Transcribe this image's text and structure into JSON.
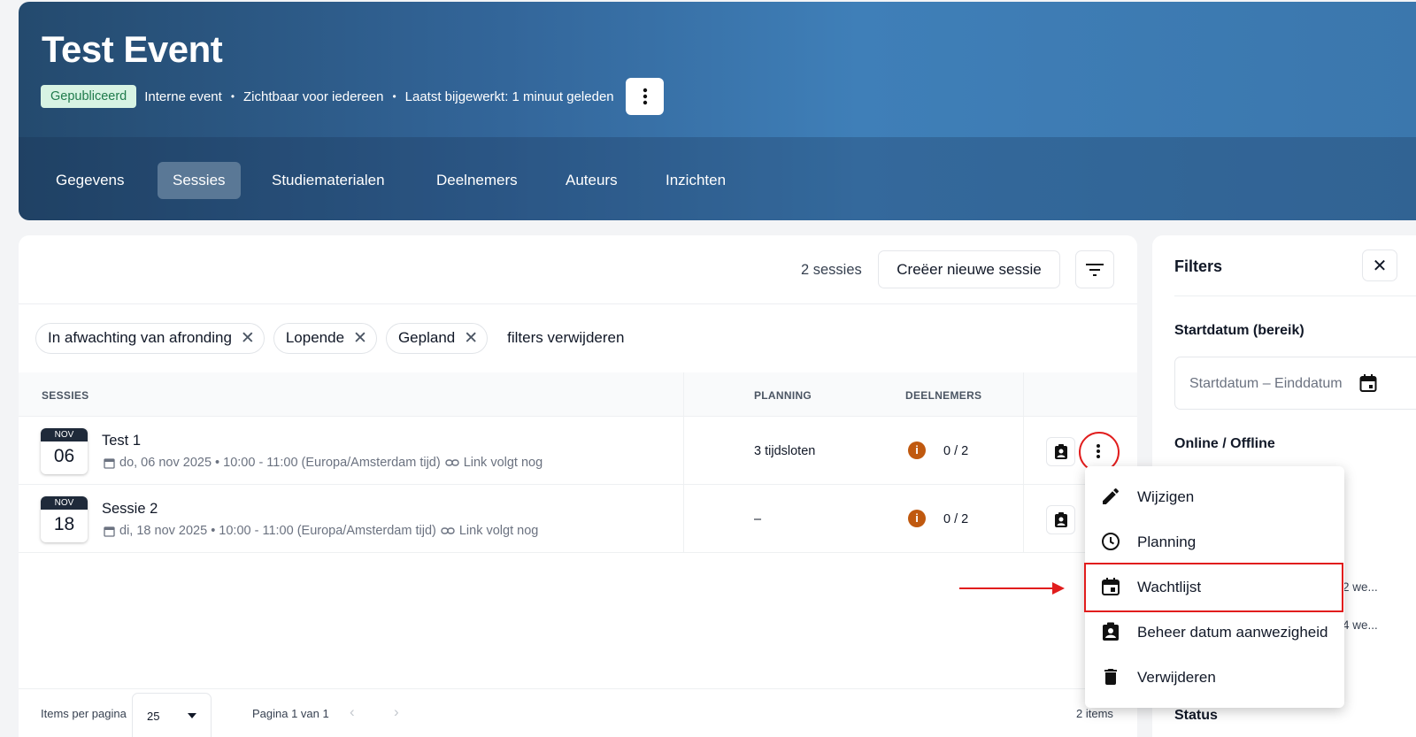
{
  "header": {
    "title": "Test Event",
    "status_badge": "Gepubliceerd",
    "meta": [
      "Interne event",
      "Zichtbaar voor iedereen",
      "Laatst bijgewerkt: 1 minuut geleden"
    ],
    "separator": "•"
  },
  "tabs": [
    {
      "label": "Gegevens",
      "active": false
    },
    {
      "label": "Sessies",
      "active": true
    },
    {
      "label": "Studiematerialen",
      "active": false
    },
    {
      "label": "Deelnemers",
      "active": false
    },
    {
      "label": "Auteurs",
      "active": false
    },
    {
      "label": "Inzichten",
      "active": false
    }
  ],
  "toolbar": {
    "count": "2 sessies",
    "create_label": "Creëer nieuwe sessie"
  },
  "chips": [
    "In afwachting van afronding",
    "Lopende",
    "Gepland"
  ],
  "clear_filters": "filters verwijderen",
  "table": {
    "headers": {
      "sessions": "SESSIES",
      "planning": "PLANNING",
      "participants": "DEELNEMERS"
    },
    "rows": [
      {
        "month": "NOV",
        "day": "06",
        "title": "Test 1",
        "datetime": "do, 06 nov 2025 • 10:00 - 11:00 (Europa/Amsterdam tijd)",
        "link": "Link volgt nog",
        "planning": "3 tijdsloten",
        "participants": "0 / 2"
      },
      {
        "month": "NOV",
        "day": "18",
        "title": "Sessie 2",
        "datetime": "di, 18 nov 2025 • 10:00 - 11:00 (Europa/Amsterdam tijd)",
        "link": "Link volgt nog",
        "planning": "–",
        "participants": "0 / 2"
      }
    ]
  },
  "footer": {
    "items_per_page_label": "Items per pagina",
    "items_per_page": "25",
    "page": "Pagina 1 van 1",
    "items": "2 items"
  },
  "filters_panel": {
    "title": "Filters",
    "start_date_label": "Startdatum (bereik)",
    "date_placeholder": "Startdatum – Einddatum",
    "online_label": "Online / Offline",
    "snippet_1": "2 we...",
    "snippet_2": "4 we...",
    "status_label": "Status"
  },
  "menu": {
    "items": [
      {
        "label": "Wijzigen",
        "icon": "pencil-icon"
      },
      {
        "label": "Planning",
        "icon": "clock-icon"
      },
      {
        "label": "Wachtlijst",
        "icon": "calendar-icon",
        "highlighted": true
      },
      {
        "label": "Beheer datum aanwezigheid",
        "icon": "badge-icon"
      },
      {
        "label": "Verwijderen",
        "icon": "trash-icon"
      }
    ]
  },
  "colors": {
    "accent_red": "#e11d1d",
    "badge_green": "#d7f3e3",
    "info_orange": "#c0590f",
    "hero_blue": "#33669a"
  }
}
